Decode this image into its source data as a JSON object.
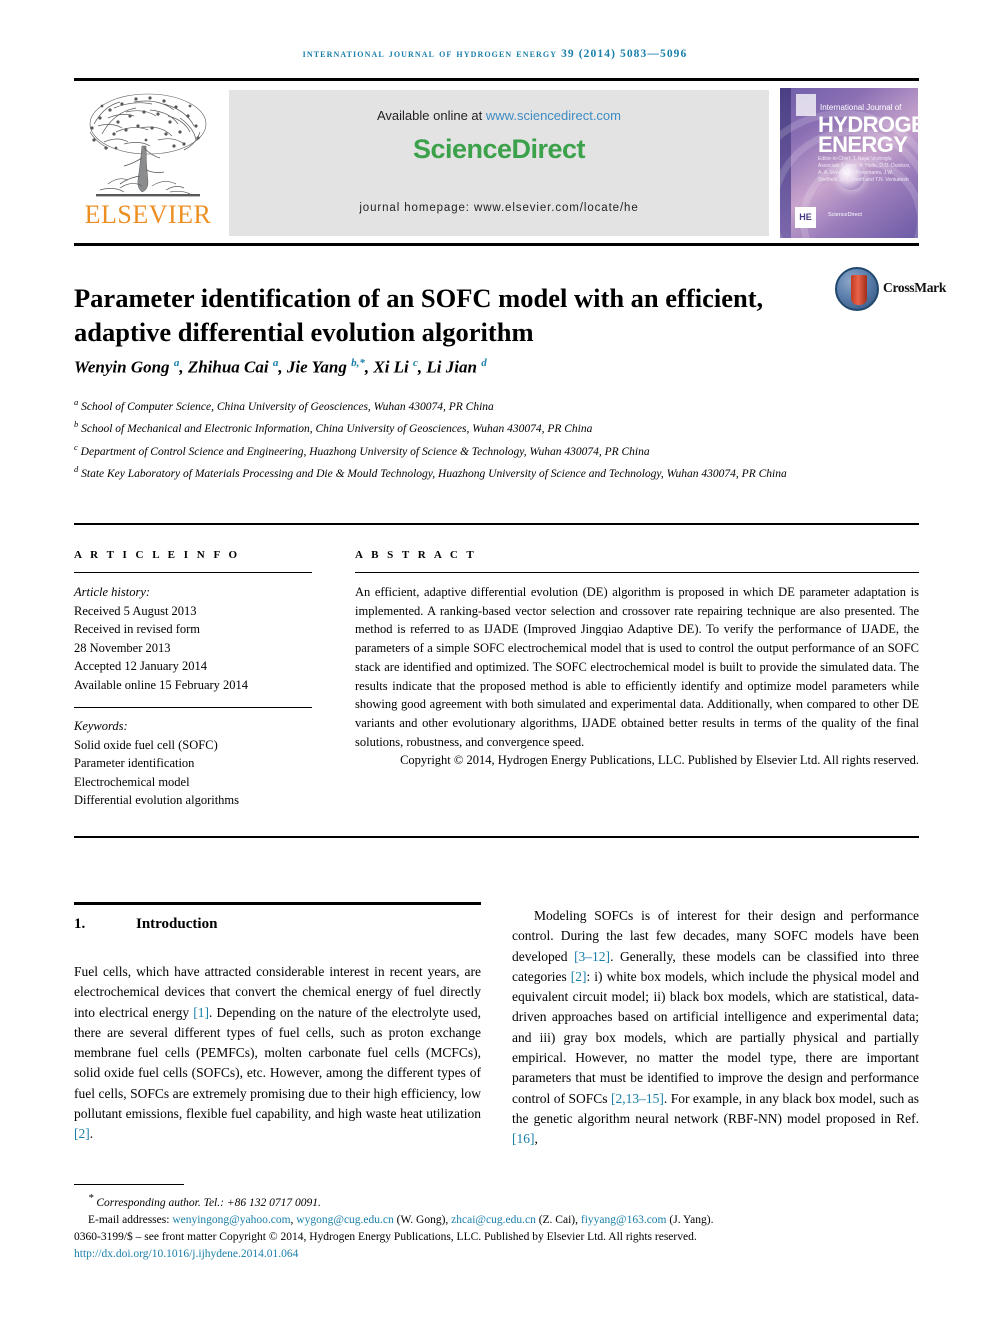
{
  "running_head": "International Journal of Hydrogen Energy 39 (2014) 5083—5096",
  "masthead": {
    "publisher_name": "ELSEVIER",
    "tree_logo": "elsevier-tree-logo",
    "available_prefix": "Available online at ",
    "available_url": "www.sciencedirect.com",
    "sciencedirect_logo": "ScienceDirect",
    "journal_homepage": "journal homepage: www.elsevier.com/locate/he",
    "cover": {
      "line_top": "International Journal of",
      "title_line1": "HYDROGEN",
      "title_line2": "ENERGY",
      "editors": "Editor-in-Chief: T. Nejat Veziroglu\nAssociate Editors: A. Hailu, D.O. Dunikov, A. A. Evers, A.L. Ponomarev, J.W. Sheffield, S.A. Sherif and T.N. Venkatesh",
      "badge": "HE",
      "sd_mini": "ScienceDirect"
    }
  },
  "article": {
    "title": "Parameter identification of an SOFC model with an efficient, adaptive differential evolution algorithm",
    "crossmark_label": "CrossMark",
    "authors_html": "Wenyin Gong <sup>a</sup>, Zhihua Cai <sup>a</sup>, Jie Yang <sup>b,*</sup>, Xi Li <sup>c</sup>, Li Jian <sup>d</sup>",
    "affiliations": [
      {
        "marker": "a",
        "text": "School of Computer Science, China University of Geosciences, Wuhan 430074, PR China"
      },
      {
        "marker": "b",
        "text": "School of Mechanical and Electronic Information, China University of Geosciences, Wuhan 430074, PR China"
      },
      {
        "marker": "c",
        "text": "Department of Control Science and Engineering, Huazhong University of Science & Technology, Wuhan 430074, PR China"
      },
      {
        "marker": "d",
        "text": "State Key Laboratory of Materials Processing and Die & Mould Technology, Huazhong University of Science and Technology, Wuhan 430074, PR China"
      }
    ]
  },
  "article_info": {
    "heading": "A R T I C L E   I N F O",
    "history_label": "Article history:",
    "history": [
      "Received 5 August 2013",
      "Received in revised form",
      "28 November 2013",
      "Accepted 12 January 2014",
      "Available online 15 February 2014"
    ],
    "keywords_label": "Keywords:",
    "keywords": [
      "Solid oxide fuel cell (SOFC)",
      "Parameter identification",
      "Electrochemical model",
      "Differential evolution algorithms"
    ]
  },
  "abstract": {
    "heading": "A B S T R A C T",
    "text": "An efficient, adaptive differential evolution (DE) algorithm is proposed in which DE parameter adaptation is implemented. A ranking-based vector selection and crossover rate repairing technique are also presented. The method is referred to as IJADE (Improved Jingqiao Adaptive DE). To verify the performance of IJADE, the parameters of a simple SOFC electrochemical model that is used to control the output performance of an SOFC stack are identified and optimized. The SOFC electrochemical model is built to provide the simulated data. The results indicate that the proposed method is able to efficiently identify and optimize model parameters while showing good agreement with both simulated and experimental data. Additionally, when compared to other DE variants and other evolutionary algorithms, IJADE obtained better results in terms of the quality of the final solutions, robustness, and convergence speed.",
    "copyright": "Copyright © 2014, Hydrogen Energy Publications, LLC. Published by Elsevier Ltd. All rights reserved."
  },
  "section": {
    "number": "1.",
    "title": "Introduction"
  },
  "body": {
    "left_paragraph_html": "Fuel cells, which have attracted considerable interest in recent years, are electrochemical devices that convert the chemical energy of fuel directly into electrical energy <span class=\"ref\">[1]</span>. Depending on the nature of the electrolyte used, there are several different types of fuel cells, such as proton exchange membrane fuel cells (PEMFCs), molten carbonate fuel cells (MCFCs), solid oxide fuel cells (SOFCs), etc. However, among the different types of fuel cells, SOFCs are extremely promising due to their high efficiency, low pollutant emissions, flexible fuel capability, and high waste heat utilization <span class=\"ref\">[2]</span>.",
    "right_paragraph_html": "Modeling SOFCs is of interest for their design and performance control. During the last few decades, many SOFC models have been developed <span class=\"ref\">[3&#8211;12]</span>. Generally, these models can be classified into three categories <span class=\"ref\">[2]</span>: i) white box models, which include the physical model and equivalent circuit model; ii) black box models, which are statistical, data-driven approaches based on artificial intelligence and experimental data; and iii) gray box models, which are partially physical and partially empirical. However, no matter the model type, there are important parameters that must be identified to improve the design and performance control of SOFCs <span class=\"ref\">[2,13&#8211;15]</span>. For example, in any black box model, such as the genetic algorithm neural network (RBF-NN) model proposed in Ref. <span class=\"ref\">[16]</span>,"
  },
  "footer": {
    "corresponding_html": "<sup class=\"star\">*</sup> <i>Corresponding author. Tel.: +86 132 0717 0091.</i>",
    "emails_html": "E-mail addresses: <span class=\"link\">wenyingong@yahoo.com</span>, <span class=\"link\">wygong@cug.edu.cn</span> (W. Gong), <span class=\"link\">zhcai@cug.edu.cn</span> (Z. Cai), <span class=\"link\">fiyyang@163.com</span> (J. Yang).",
    "issn_line": "0360-3199/$ – see front matter Copyright © 2014, Hydrogen Energy Publications, LLC. Published by Elsevier Ltd. All rights reserved.",
    "doi": "http://dx.doi.org/10.1016/j.ijhydene.2014.01.064"
  },
  "colors": {
    "link": "#1a7fa8",
    "sciencedirect_green": "#3ba14b",
    "elsevier_orange": "#ec8e22",
    "running_head": "#1a7fa8"
  }
}
